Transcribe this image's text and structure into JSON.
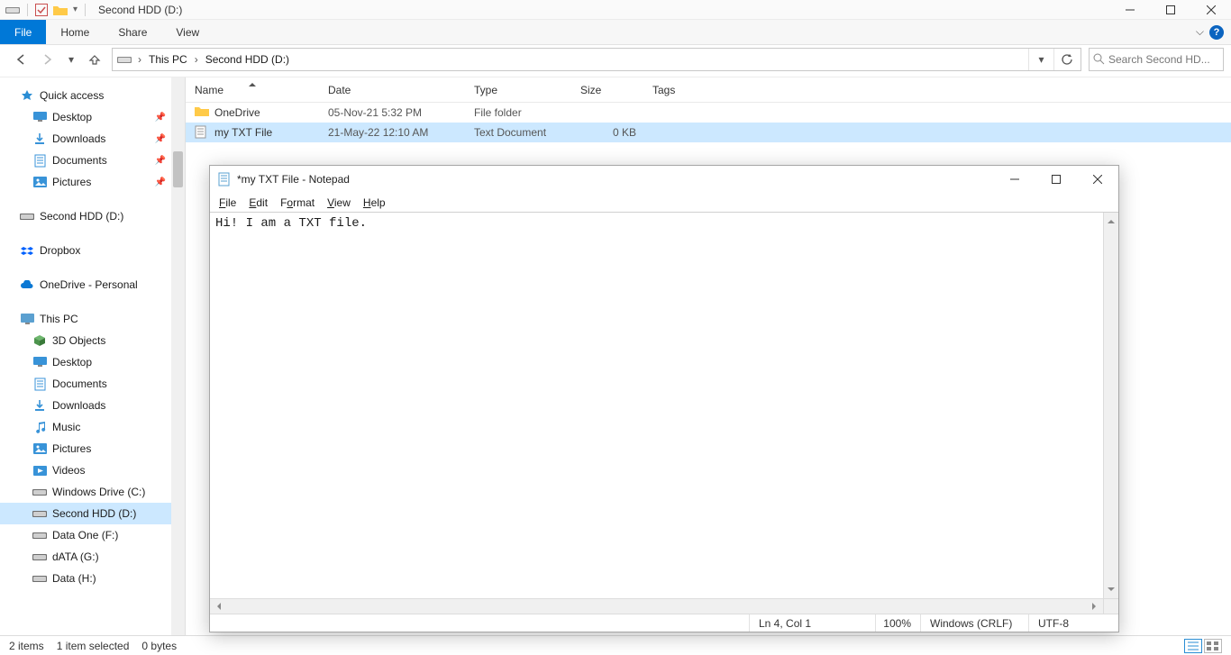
{
  "explorer": {
    "window_title": "Second HDD (D:)",
    "tabs": {
      "file": "File",
      "home": "Home",
      "share": "Share",
      "view": "View"
    },
    "breadcrumbs": [
      "This PC",
      "Second HDD (D:)"
    ],
    "search_placeholder": "Search Second HD...",
    "columns": {
      "name": "Name",
      "date": "Date",
      "type": "Type",
      "size": "Size",
      "tags": "Tags"
    },
    "rows": [
      {
        "name": "OneDrive",
        "date": "05-Nov-21 5:32 PM",
        "type": "File folder",
        "size": "",
        "icon": "folder"
      },
      {
        "name": "my TXT File",
        "date": "21-May-22 12:10 AM",
        "type": "Text Document",
        "size": "0 KB",
        "icon": "txt",
        "selected": true
      }
    ],
    "nav": {
      "quick_access": "Quick access",
      "qa_items": [
        {
          "label": "Desktop",
          "ico": "desktop",
          "pinned": true
        },
        {
          "label": "Downloads",
          "ico": "downloads",
          "pinned": true
        },
        {
          "label": "Documents",
          "ico": "documents",
          "pinned": true
        },
        {
          "label": "Pictures",
          "ico": "pictures",
          "pinned": true
        }
      ],
      "second_hdd": "Second HDD (D:)",
      "dropbox": "Dropbox",
      "onedrive": "OneDrive - Personal",
      "this_pc": "This PC",
      "pc_items": [
        {
          "label": "3D Objects",
          "ico": "cube"
        },
        {
          "label": "Desktop",
          "ico": "desktop"
        },
        {
          "label": "Documents",
          "ico": "documents"
        },
        {
          "label": "Downloads",
          "ico": "downloads"
        },
        {
          "label": "Music",
          "ico": "music"
        },
        {
          "label": "Pictures",
          "ico": "pictures"
        },
        {
          "label": "Videos",
          "ico": "videos"
        },
        {
          "label": "Windows Drive (C:)",
          "ico": "drive"
        },
        {
          "label": "Second HDD (D:)",
          "ico": "drive",
          "selected": true
        },
        {
          "label": "Data One (F:)",
          "ico": "drive"
        },
        {
          "label": "dATA (G:)",
          "ico": "drive"
        },
        {
          "label": "Data (H:)",
          "ico": "drive"
        }
      ]
    },
    "status": {
      "items": "2 items",
      "selection": "1 item selected",
      "size": "0 bytes"
    }
  },
  "notepad": {
    "title": "*my TXT File - Notepad",
    "menu": [
      "File",
      "Edit",
      "Format",
      "View",
      "Help"
    ],
    "content": "Hi! I am a TXT file.",
    "status": {
      "position": "Ln 4, Col 1",
      "zoom": "100%",
      "eol": "Windows (CRLF)",
      "encoding": "UTF-8"
    }
  }
}
